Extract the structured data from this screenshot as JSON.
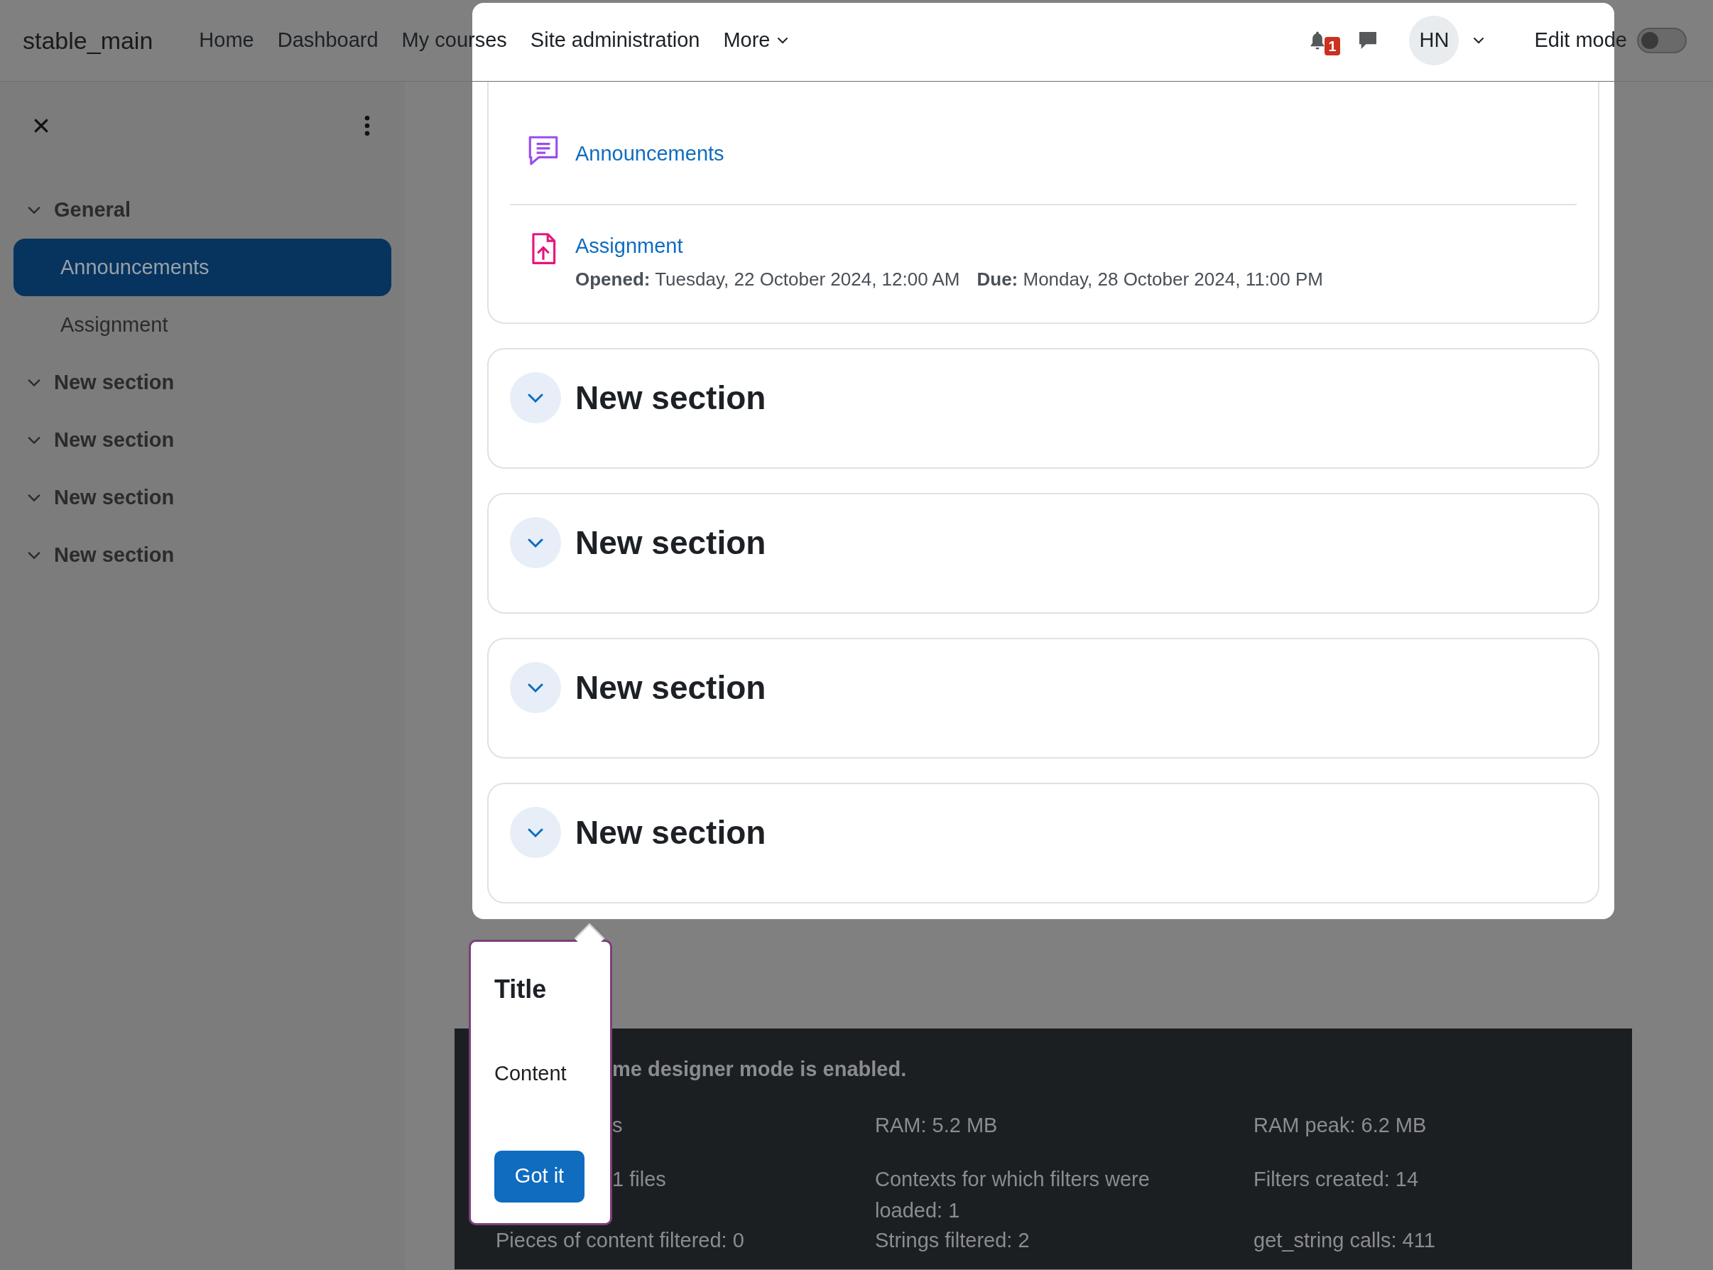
{
  "navbar": {
    "site_name": "stable_main",
    "links": [
      {
        "label": "Home"
      },
      {
        "label": "Dashboard"
      },
      {
        "label": "My courses"
      },
      {
        "label": "Site administration"
      },
      {
        "label": "More",
        "kind": "dropdown"
      }
    ],
    "notification_count": "1",
    "user_initials": "HN",
    "edit_mode": {
      "label": "Edit mode",
      "on": false
    }
  },
  "course_index": {
    "sections": [
      {
        "title": "General",
        "expanded": true,
        "children": [
          {
            "label": "Announcements",
            "selected": true
          },
          {
            "label": "Assignment",
            "selected": false
          }
        ]
      },
      {
        "title": "New section",
        "expanded": true
      },
      {
        "title": "New section",
        "expanded": true
      },
      {
        "title": "New section",
        "expanded": true
      },
      {
        "title": "New section",
        "expanded": true
      }
    ]
  },
  "course_content": {
    "activities": [
      {
        "kind": "forum",
        "name": "Announcements"
      },
      {
        "kind": "assignment",
        "name": "Assignment",
        "dates": [
          "**Opened:** Tuesday, 22 October 2024, 12:00 AM",
          "**Due:** Monday, 28 October 2024, 11:00 PM"
        ]
      }
    ],
    "sections": [
      {
        "title": "New section",
        "expanded": true
      },
      {
        "title": "New section",
        "expanded": true
      },
      {
        "title": "New section",
        "expanded": true
      },
      {
        "title": "New section",
        "expanded": true
      }
    ]
  },
  "tour_popover": {
    "title": "Title",
    "content": "Content",
    "button": "Got it"
  },
  "footer": {
    "notice": {
      "text": "me designer mode is enabled.",
      "clipped": true
    },
    "rows": [
      [
        {
          "text": "s",
          "clipped": true
        },
        {
          "text": "RAM: 5.2 MB",
          "clipped": false
        },
        {
          "text": "RAM peak: 6.2 MB",
          "clipped": false
        }
      ],
      [
        {
          "text": "1 files",
          "clipped": true
        },
        {
          "text": "Contexts for which filters were loaded: 1",
          "clipped": false
        },
        {
          "text": "Filters created: 14",
          "clipped": false
        }
      ],
      [
        {
          "text": "Pieces of content filtered: 0",
          "clipped": false
        },
        {
          "text": "Strings filtered: 2",
          "clipped": false
        },
        {
          "text": "get_string calls: 411",
          "clipped": false
        }
      ]
    ]
  }
}
